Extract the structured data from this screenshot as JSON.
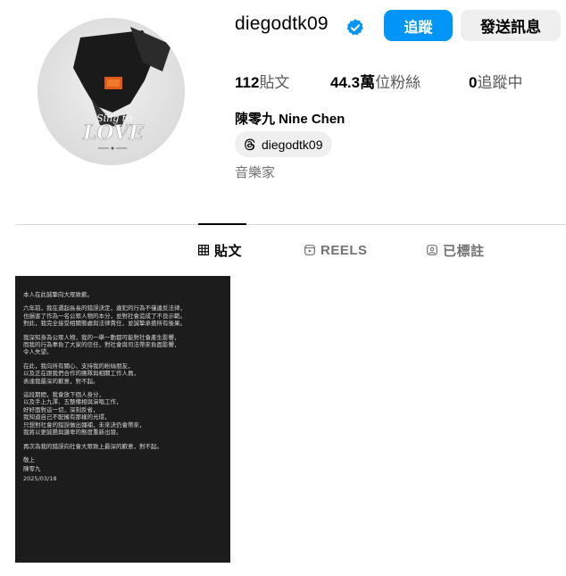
{
  "profile": {
    "username": "diegodtk09",
    "verified": true,
    "follow_label": "追蹤",
    "message_label": "發送訊息",
    "stats": {
      "posts_num": "112",
      "posts_label": "貼文",
      "followers_num": "44.3萬",
      "followers_label": "位粉絲",
      "following_num": "0",
      "following_label": "追蹤中"
    },
    "full_name": "陳零九 Nine Chen",
    "threads_handle": "diegodtk09",
    "category": "音樂家",
    "avatar": {
      "title_line1": "Sing to",
      "title_line2": "LOVE"
    }
  },
  "colors": {
    "accent": "#0095f6",
    "verified": "#0095f6",
    "secondary_text": "#737373",
    "chip_bg": "#efefef"
  },
  "tabs": [
    {
      "label": "貼文",
      "icon": "grid-icon",
      "active": true
    },
    {
      "label": "REELS",
      "icon": "reels-icon",
      "active": false
    },
    {
      "label": "已標註",
      "icon": "tagged-icon",
      "active": false
    }
  ],
  "posts": [
    {
      "paragraphs": [
        "本人在此誠摯向大眾致歉。",
        "六年前，我在遇起長長的錯誤決定，違犯的行為不僅違反法律，\n也損害了作為一名公眾人物的本分，並對社會造成了不良示範。\n對此，我完全接受相關懲處與法律責任，並誠摯承擔所有後果。",
        "我深知身為公眾人物，我的一舉一動都可能對社會產生影響，\n而我的行為辜負了大家的信任，對社會與司法帶來負面影響，\n令人失望。",
        "在此，我向所有關心、支持我的粉絲朋友，\n以及正在跟我們合作的團隊與相關工作人員，\n表達我最深的歉意，對不起。",
        "這段期間，我會放下個人身分，\n以及手上九澤、五整備相與演唱工作，\n好好面對這一切，深刻反省，\n我知道自己不配擁有那樣的光環，\n只想對社會的錯誤做出彌補，未來決仍會帶來，\n我將以更誠懇與謙卑的態度重新出發。",
        "再次為我的錯誤向社會大眾致上最深的歉意，對不起。",
        "敬上",
        "陳零九",
        "2025/03/18"
      ]
    }
  ]
}
